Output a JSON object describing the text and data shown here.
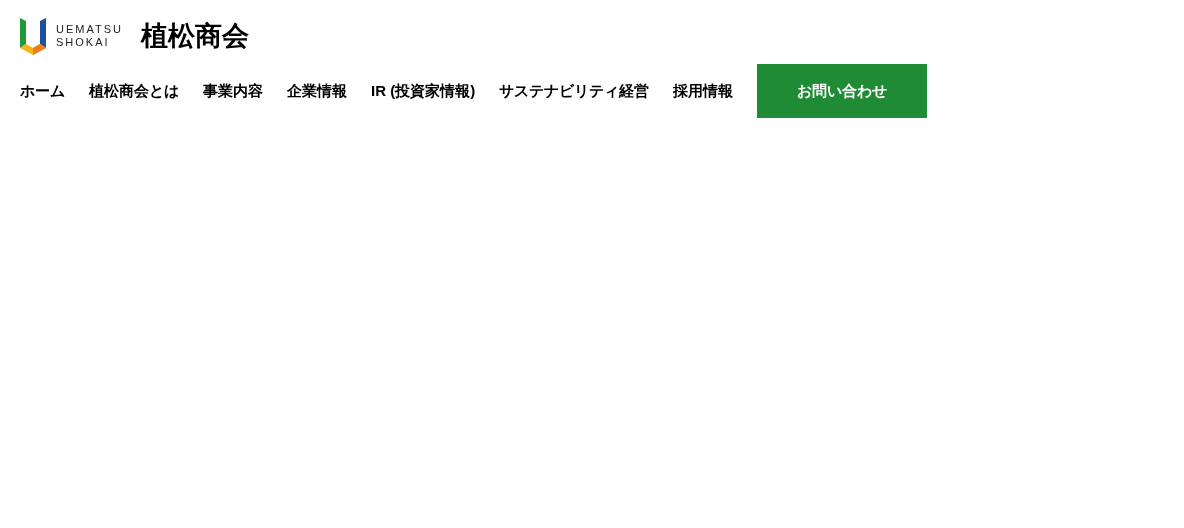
{
  "logo": {
    "line_1": "UEMATSU",
    "line_2": "SHOKAI",
    "name": "植松商会"
  },
  "nav": [
    {
      "label": "ホーム"
    },
    {
      "label": "植松商会とは"
    },
    {
      "label": "事業内容"
    },
    {
      "label": "企業情報"
    },
    {
      "label": "IR (投資家情報)"
    },
    {
      "label": "サステナビリティ経営"
    },
    {
      "label": "採用情報"
    }
  ],
  "contact_button": "お問い合わせ"
}
